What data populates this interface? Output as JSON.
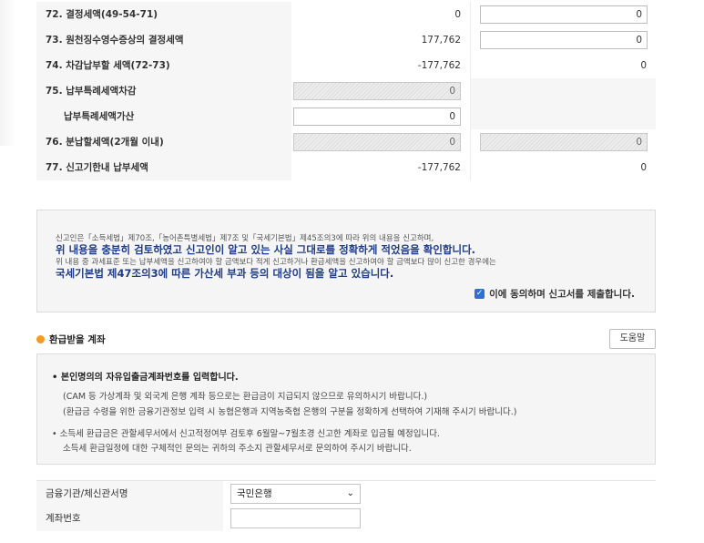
{
  "table": {
    "rows": [
      {
        "label": "72. 결정세액(49-54-71)",
        "col1": "0",
        "col2": "0"
      },
      {
        "label": "73. 원천징수영수증상의 결정세액",
        "col1": "177,762",
        "col2": "0"
      },
      {
        "label": "74. 차감납부할 세액(72-73)",
        "col1": "-177,762",
        "col2": "0"
      },
      {
        "label": "75. 납부특례세액차감",
        "col1": "0",
        "col2": ""
      },
      {
        "label": "납부특례세액가산",
        "col1": "0",
        "col2": ""
      },
      {
        "label": "76. 분납할세액(2개월 이내)",
        "col1": "0",
        "col2": "0"
      },
      {
        "label": "77. 신고기한내 납부세액",
        "col1": "-177,762",
        "col2": "0"
      }
    ]
  },
  "notice": {
    "line1": "신고인은「소득세법」제70조,「농어촌특별세법」제7조 및「국세기본법」제45조의3에 따라 위의 내용을 신고하며,",
    "line2": "위 내용을 충분히 검토하였고 신고인이 알고 있는 사실 그대로를 정확하게 적었음을 확인합니다.",
    "line3": "위 내용 중 과세표준 또는 납부세액을 신고하여야 할 금액보다 적게 신고하거나 환급세액을 신고하여야 할 금액보다 많이 신고한 경우에는",
    "line4": "국세기본법 제47조의3에 따른 가산세 부과 등의 대상이 됨을 알고 있습니다.",
    "agree_label": "이에 동의하며 신고서를 제출합니다."
  },
  "refund": {
    "title": "환급받을 계좌",
    "help_label": "도움말",
    "info": {
      "head": "본인명의의 자유입출금계좌번호를 입력합니다.",
      "p1": "(CAM 등 가상계좌 및 외국계 은행 계좌 등으로는 환급금이 지급되지 않으므로 유의하시기 바랍니다.)",
      "p2": "(환급금 수령을 위한 금융기관정보 입력 시 농협은행과 지역농축협 은행의 구분을 정확하게 선택하여 기재해 주시기 바랍니다.)",
      "p3": "소득세 환급금은 관할세무서에서 신고적정여부 검토후 6월말~7월초경 신고한 계좌로 입금될 예정입니다.",
      "p4": "소득세 환급일정에 대한 구체적인 문의는 귀하의 주소지 관할세무서로 문의하여 주시기 바랍니다."
    },
    "bank_label": "금융기관/체신관서명",
    "bank_value": "국민은행",
    "account_label": "계좌번호",
    "account_value": ""
  },
  "colors": {
    "accent": "#1f3c88",
    "checkbox": "#2f6fd6",
    "section_dot": "#f59a23"
  }
}
